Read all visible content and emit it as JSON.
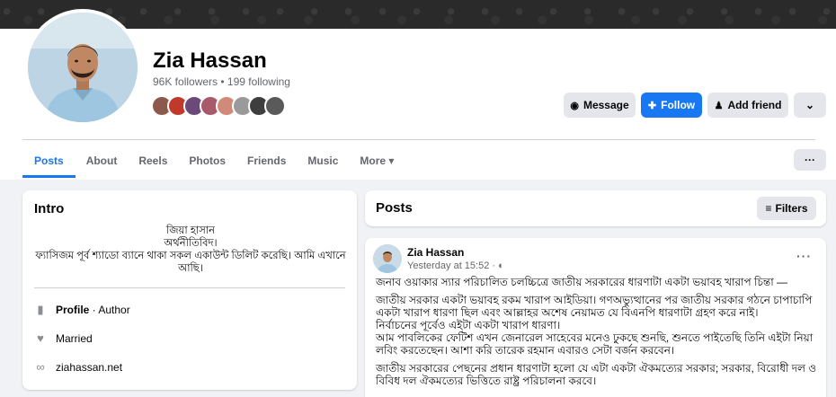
{
  "profile": {
    "name": "Zia Hassan",
    "follow_counts": "96K followers • 199 following",
    "friend_avatar_colors": [
      "#8c5a4b",
      "#c0392b",
      "#6b4a7a",
      "#a85a6b",
      "#d08a7a",
      "#9a9a9a",
      "#3e3e3e",
      "#5a5a5a"
    ]
  },
  "actions": {
    "message": "Message",
    "follow": "Follow",
    "add_friend": "Add friend",
    "more_icon": "chevron-down-icon"
  },
  "tabs": [
    {
      "label": "Posts",
      "active": true
    },
    {
      "label": "About"
    },
    {
      "label": "Reels"
    },
    {
      "label": "Photos"
    },
    {
      "label": "Friends"
    },
    {
      "label": "Music"
    },
    {
      "label": "More ▾"
    }
  ],
  "tab_more_label": "···",
  "intro": {
    "title": "Intro",
    "bio_line1": "জিয়া হাসান",
    "bio_line2": "অর্থনীতিবিদ।",
    "bio_line3": "ফ্যাসিজম পূর্ব শ্যাডো ব্যানে থাকা সকল একাউন্ট ডিলিট করেছি। আমি এখানে আছি।",
    "profile_label": "Profile",
    "profile_type": " · Author",
    "relationship": "Married",
    "website": "ziahassan.net"
  },
  "posts": {
    "title": "Posts",
    "filters_label": "Filters"
  },
  "post": {
    "author": "Zia Hassan",
    "time": "Yesterday at 15:52 · ",
    "menu": "···",
    "p1": "জনাব ওয়াকার স্যার পরিচালিত চলচ্চিত্রে জাতীয় সরকারের  ধারণাটা একটা ভয়াবহ খারাপ চিন্তা —",
    "p2": "জাতীয় সরকার একটা ভয়াবহ রকম খারাপ আইডিয়া। গণঅভ্যুত্থানের পর জাতীয় সরকার গঠনে চাপাচাপি একটা খারাপ ধারণা ছিল এবং আল্লাহর অশেষ নেয়ামত যে বিএনপি ধারণাটা গ্রহণ করে নাই।",
    "p3": "নির্বাচনের পূর্বেও এইটা একটা খারাপ ধারণা।",
    "p4": "আম পাবলিকের ফেটিশ এখন জেনারেল সাহেবের মনেও ঢুকছে শুনছি, শুনতে  পাইতেছি তিনি এইটা নিয়া লবিং করতেছেন। আশা করি তারেক রহমান এবারও সেটা বর্জন করবেন।",
    "p5": "জাতীয় সরকারের পেছনের প্রধান ধারণাটা হলো যে এটা একটা ঐকমত্যের সরকার; সরকার, বিরোধী দল ও বিবিধ দল ঐকমত্যের ভিত্তিতে রাষ্ট্র পরিচালনা করবে।"
  },
  "colors": {
    "accent": "#1877f2",
    "background": "#f0f2f5",
    "secondary_text": "#65676b"
  }
}
